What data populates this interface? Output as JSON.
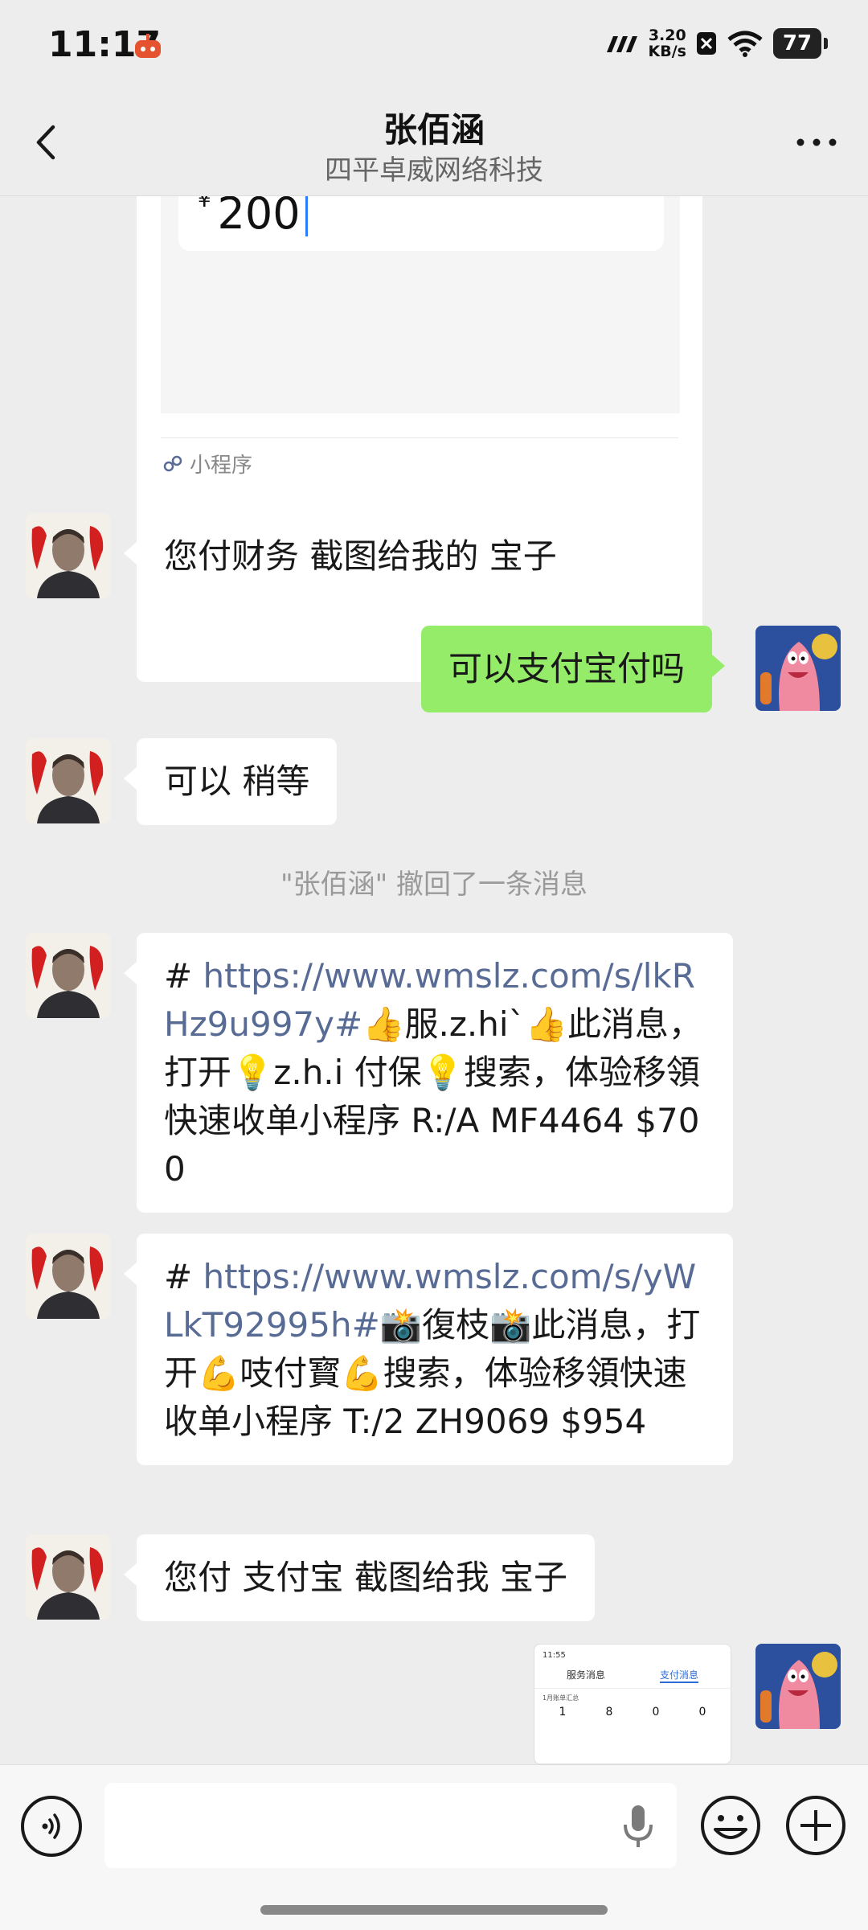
{
  "status_bar": {
    "time": "11:17",
    "net_speed_value": "3.20",
    "net_speed_unit": "KB/s",
    "battery": "77"
  },
  "header": {
    "contact_name": "张佰涵",
    "contact_company": "四平卓威网络科技"
  },
  "mini_program_card": {
    "amount": "200",
    "currency_symbol": "¥",
    "footer_label": "小程序"
  },
  "messages": [
    {
      "side": "left",
      "text": "您付财务 截图给我的 宝子"
    },
    {
      "side": "right",
      "text": "可以支付宝付吗"
    },
    {
      "side": "left",
      "text": "可以 稍等"
    },
    {
      "side": "system",
      "text": "\"张佰涵\" 撤回了一条消息"
    },
    {
      "side": "left",
      "hash": "# ",
      "link": "https://www.wmslz.com/s/lkRHz9u997y#",
      "rest": "👍服.z.hi`👍此消息，打开💡z.h.i 付保💡搜索，体验移領快速收单小程序  R:/A MF4464 $700"
    },
    {
      "side": "left",
      "hash": "# ",
      "link": "https://www.wmslz.com/s/yWLkT92995h#",
      "rest": "📸復枝📸此消息，打开💪吱付寳💪搜索，体验移領快速收单小程序  T:/2 ZH9069 $954"
    },
    {
      "side": "left",
      "text": "您付 支付宝 截图给我 宝子"
    }
  ],
  "screenshot_thumb": {
    "time": "11:55",
    "tab_service": "服务消息",
    "tab_payment": "支付消息",
    "caption": "1月账单汇总",
    "nums": [
      "1",
      "8",
      "0",
      "0"
    ]
  },
  "input_bar": {
    "placeholder": ""
  },
  "colors": {
    "bg": "#ededed",
    "bubble_self": "#95ec69",
    "link": "#576b95"
  },
  "icons": [
    "back-arrow-icon",
    "more-icon",
    "voice-icon",
    "mic-icon",
    "emoji-icon",
    "plus-icon",
    "mini-program-icon"
  ]
}
